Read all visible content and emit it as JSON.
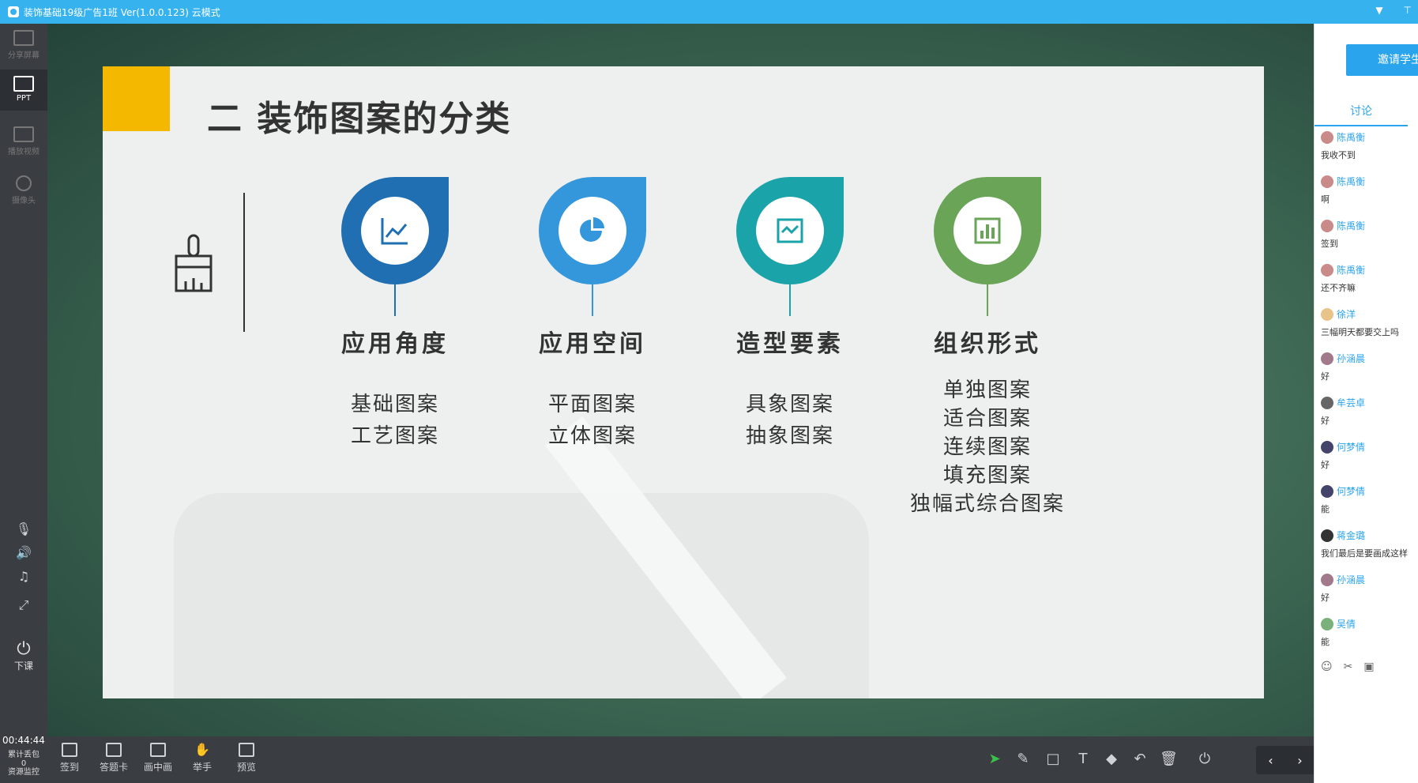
{
  "window": {
    "title": "装饰基础19级广告1班 Ver(1.0.0.123)  云模式"
  },
  "leftbar": {
    "items": [
      {
        "label": "分享屏幕",
        "icon": "share-screen-icon"
      },
      {
        "label": "PPT",
        "icon": "ppt-icon"
      },
      {
        "label": "播放视频",
        "icon": "play-video-icon"
      },
      {
        "label": "摄像头",
        "icon": "camera-icon"
      }
    ],
    "end_class": "下课",
    "timer": "00:44:44",
    "packet_label": "累计丢包",
    "packet_value": "0",
    "monitor_label": "资源监控"
  },
  "slide": {
    "title": "二 装饰图案的分类",
    "columns": [
      {
        "heading": "应用角度",
        "items": [
          "基础图案",
          "工艺图案"
        ],
        "color": "#1f6fb2"
      },
      {
        "heading": "应用空间",
        "items": [
          "平面图案",
          "立体图案"
        ],
        "color": "#3497dc"
      },
      {
        "heading": "造型要素",
        "items": [
          "具象图案",
          "抽象图案"
        ],
        "color": "#1aa3a8"
      },
      {
        "heading": "组织形式",
        "items": [
          "单独图案",
          "适合图案",
          "连续图案",
          "填充图案",
          "独幅式综合图案"
        ],
        "color": "#6aa457"
      }
    ]
  },
  "bottombar": {
    "items": [
      "签到",
      "答题卡",
      "画中画",
      "举手",
      "预览"
    ]
  },
  "rightpanel": {
    "invite_label": "邀请学生",
    "tab_label": "讨论",
    "messages": [
      {
        "name": "陈禹衡",
        "text": "我收不到"
      },
      {
        "name": "陈禹衡",
        "text": "啊"
      },
      {
        "name": "陈禹衡",
        "text": "签到"
      },
      {
        "name": "陈禹衡",
        "text": "还不齐嘛"
      },
      {
        "name": "徐洋",
        "text": "三幅明天都要交上吗"
      },
      {
        "name": "孙涵晨",
        "text": "好"
      },
      {
        "name": "牟芸卓",
        "text": "好"
      },
      {
        "name": "何梦倩",
        "text": "好"
      },
      {
        "name": "何梦倩",
        "text": "能"
      },
      {
        "name": "蒋金璐",
        "text": "我们最后是要画成这样"
      },
      {
        "name": "孙涵晨",
        "text": "好"
      },
      {
        "name": "吴倩",
        "text": "能"
      }
    ]
  }
}
